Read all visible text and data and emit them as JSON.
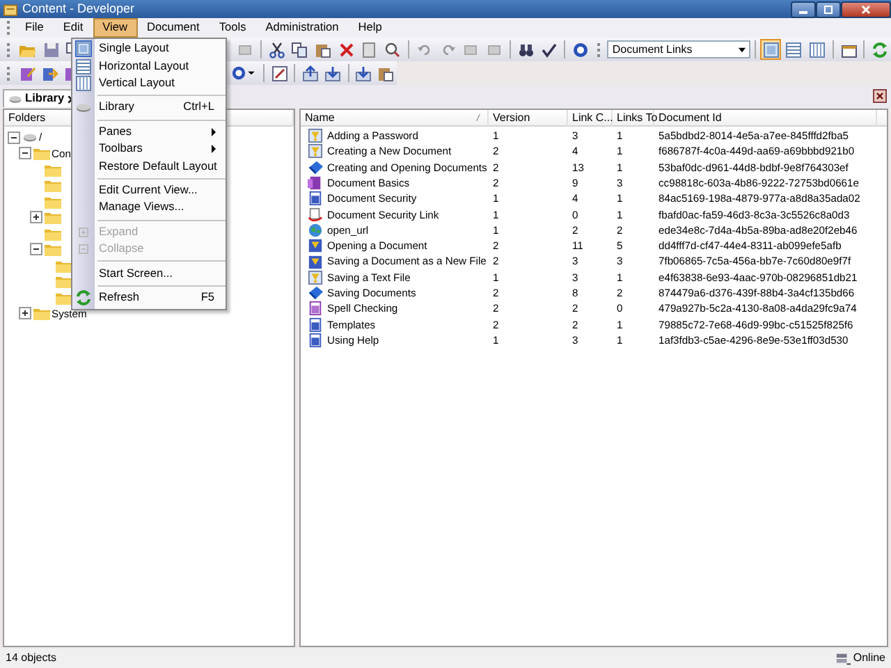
{
  "window": {
    "title": "Content - Developer"
  },
  "menu_bar": [
    {
      "label": "File",
      "selected": false
    },
    {
      "label": "Edit",
      "selected": false
    },
    {
      "label": "View",
      "selected": true
    },
    {
      "label": "Document",
      "selected": false
    },
    {
      "label": "Tools",
      "selected": false
    },
    {
      "label": "Administration",
      "selected": false
    },
    {
      "label": "Help",
      "selected": false
    }
  ],
  "view_menu": [
    {
      "kind": "item",
      "label": "Single Layout",
      "checked": true
    },
    {
      "kind": "item",
      "label": "Horizontal Layout",
      "checked": false
    },
    {
      "kind": "item",
      "label": "Vertical Layout",
      "checked": false
    },
    {
      "kind": "separator"
    },
    {
      "kind": "item",
      "label": "Library",
      "shortcut": "Ctrl+L"
    },
    {
      "kind": "separator"
    },
    {
      "kind": "submenu",
      "label": "Panes"
    },
    {
      "kind": "submenu",
      "label": "Toolbars"
    },
    {
      "kind": "item",
      "label": "Restore Default Layout"
    },
    {
      "kind": "separator"
    },
    {
      "kind": "item",
      "label": "Edit Current View..."
    },
    {
      "kind": "item",
      "label": "Manage Views..."
    },
    {
      "kind": "separator"
    },
    {
      "kind": "item",
      "label": "Expand",
      "disabled": true
    },
    {
      "kind": "item",
      "label": "Collapse",
      "disabled": true
    },
    {
      "kind": "separator"
    },
    {
      "kind": "item",
      "label": "Start Screen..."
    },
    {
      "kind": "separator"
    },
    {
      "kind": "item",
      "label": "Refresh",
      "shortcut": "F5"
    }
  ],
  "toolbar": {
    "view_select": {
      "value": "Document Links"
    },
    "layout_buttons": [
      {
        "selected": true
      },
      {
        "selected": false
      },
      {
        "selected": false
      }
    ]
  },
  "tabs": [
    {
      "label": "Library",
      "selected": true
    }
  ],
  "folders": {
    "title": "Folders",
    "tree": [
      {
        "kind": "drive",
        "label": "/",
        "expanded": true,
        "children": [
          {
            "kind": "folder",
            "label": "Con",
            "expanded": true,
            "children": [
              {
                "kind": "folder"
              },
              {
                "kind": "folder"
              },
              {
                "kind": "folder"
              },
              {
                "kind": "folder",
                "expanded": false
              },
              {
                "kind": "folder"
              },
              {
                "kind": "folder",
                "expanded": true,
                "children": [
                  {
                    "kind": "folder"
                  },
                  {
                    "kind": "folder"
                  },
                  {
                    "kind": "folder"
                  }
                ]
              }
            ]
          },
          {
            "kind": "folder",
            "label": "System",
            "expanded": false
          }
        ]
      }
    ]
  },
  "table": {
    "columns": [
      "Name",
      "Version",
      "Link C...",
      "Links To",
      "Document Id"
    ],
    "rows": [
      {
        "kind": "topic",
        "name": "Adding a Password",
        "version": "1",
        "link_count": "3",
        "links_to": "1",
        "document_id": "5a5bdbd2-8014-4e5a-a7ee-845fffd2fba5"
      },
      {
        "kind": "topic",
        "name": "Creating a New Document",
        "version": "2",
        "link_count": "4",
        "links_to": "1",
        "document_id": "f686787f-4c0a-449d-aa69-a69bbbd921b0"
      },
      {
        "kind": "book",
        "name": "Creating and Opening Documents",
        "version": "2",
        "link_count": "13",
        "links_to": "1",
        "document_id": "53baf0dc-d961-44d8-bdbf-9e8f764303ef"
      },
      {
        "kind": "purple-book",
        "name": "Document Basics",
        "version": "2",
        "link_count": "9",
        "links_to": "3",
        "document_id": "cc98818c-603a-4b86-9222-72753bd0661e"
      },
      {
        "kind": "page",
        "name": "Document Security",
        "version": "1",
        "link_count": "4",
        "links_to": "1",
        "document_id": "84ac5169-198a-4879-977a-a8d8a35ada02"
      },
      {
        "kind": "link",
        "name": "Document Security Link",
        "version": "1",
        "link_count": "0",
        "links_to": "1",
        "document_id": "fbafd0ac-fa59-46d3-8c3a-3c5526c8a0d3"
      },
      {
        "kind": "url",
        "name": "open_url",
        "version": "1",
        "link_count": "2",
        "links_to": "2",
        "document_id": "ede34e8c-7d4a-4b5a-89ba-ad8e20f2eb46"
      },
      {
        "kind": "topic-page",
        "name": "Opening a Document",
        "version": "2",
        "link_count": "11",
        "links_to": "5",
        "document_id": "dd4fff7d-cf47-44e4-8311-ab099efe5afb"
      },
      {
        "kind": "topic-page",
        "name": "Saving a Document as a New File",
        "version": "2",
        "link_count": "3",
        "links_to": "3",
        "document_id": "7fb06865-7c5a-456a-bb7e-7c60d80e9f7f"
      },
      {
        "kind": "topic",
        "name": "Saving a Text File",
        "version": "1",
        "link_count": "3",
        "links_to": "1",
        "document_id": "e4f63838-6e93-4aac-970b-08296851db21"
      },
      {
        "kind": "book",
        "name": "Saving Documents",
        "version": "2",
        "link_count": "8",
        "links_to": "2",
        "document_id": "874479a6-d376-439f-88b4-3a4cf135bd66"
      },
      {
        "kind": "purple-page",
        "name": "Spell Checking",
        "version": "2",
        "link_count": "2",
        "links_to": "0",
        "document_id": "479a927b-5c2a-4130-8a08-a4da29fc9a74"
      },
      {
        "kind": "page",
        "name": "Templates",
        "version": "2",
        "link_count": "2",
        "links_to": "1",
        "document_id": "79885c72-7e68-46d9-99bc-c51525f825f6"
      },
      {
        "kind": "page",
        "name": "Using Help",
        "version": "1",
        "link_count": "3",
        "links_to": "1",
        "document_id": "1af3fdb3-c5ae-4296-8e9e-53e1ff03d530"
      }
    ]
  },
  "status_bar": {
    "count": "14 objects",
    "connection": "Online"
  }
}
